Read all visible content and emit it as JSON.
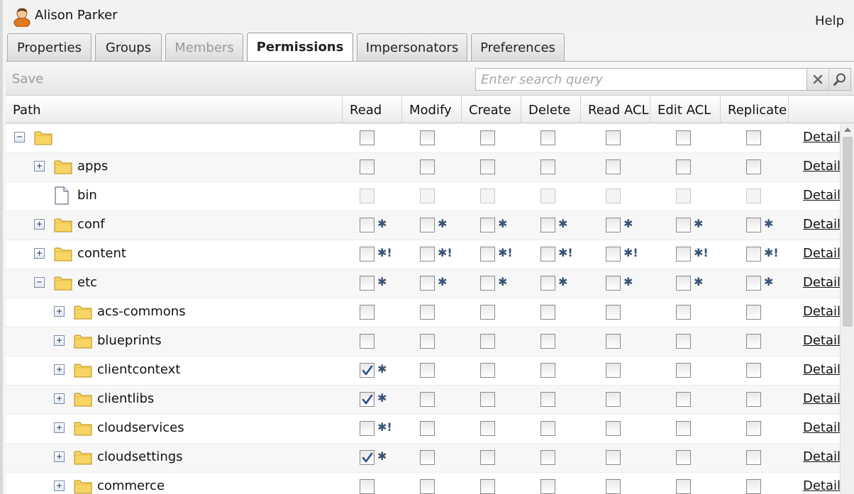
{
  "header": {
    "user_name": "Alison Parker",
    "help_label": "Help"
  },
  "tabs": [
    {
      "label": "Properties",
      "state": "normal"
    },
    {
      "label": "Groups",
      "state": "normal"
    },
    {
      "label": "Members",
      "state": "disabled"
    },
    {
      "label": "Permissions",
      "state": "active"
    },
    {
      "label": "Impersonators",
      "state": "normal"
    },
    {
      "label": "Preferences",
      "state": "normal"
    }
  ],
  "toolbar": {
    "save_label": "Save",
    "search_placeholder": "Enter search query",
    "search_value": ""
  },
  "columns": {
    "path": "Path",
    "permissions": [
      "Read",
      "Modify",
      "Create",
      "Delete",
      "Read ACL",
      "Edit ACL",
      "Replicate"
    ]
  },
  "details_label": "Details",
  "rows": [
    {
      "label": "",
      "depth": 0,
      "expander": "minus",
      "icon": "folder-icon",
      "perms": [
        {
          "checked": false,
          "mark": ""
        },
        {
          "checked": false,
          "mark": ""
        },
        {
          "checked": false,
          "mark": ""
        },
        {
          "checked": false,
          "mark": ""
        },
        {
          "checked": false,
          "mark": ""
        },
        {
          "checked": false,
          "mark": ""
        },
        {
          "checked": false,
          "mark": ""
        }
      ]
    },
    {
      "label": "apps",
      "depth": 1,
      "expander": "plus",
      "icon": "folder-icon",
      "perms": [
        {
          "checked": false,
          "mark": ""
        },
        {
          "checked": false,
          "mark": ""
        },
        {
          "checked": false,
          "mark": ""
        },
        {
          "checked": false,
          "mark": ""
        },
        {
          "checked": false,
          "mark": ""
        },
        {
          "checked": false,
          "mark": ""
        },
        {
          "checked": false,
          "mark": ""
        }
      ]
    },
    {
      "label": "bin",
      "depth": 1,
      "expander": "none",
      "icon": "file-icon",
      "disabled": true,
      "perms": [
        {
          "checked": false,
          "mark": ""
        },
        {
          "checked": false,
          "mark": ""
        },
        {
          "checked": false,
          "mark": ""
        },
        {
          "checked": false,
          "mark": ""
        },
        {
          "checked": false,
          "mark": ""
        },
        {
          "checked": false,
          "mark": ""
        },
        {
          "checked": false,
          "mark": ""
        }
      ]
    },
    {
      "label": "conf",
      "depth": 1,
      "expander": "plus",
      "icon": "folder-icon",
      "perms": [
        {
          "checked": false,
          "mark": "✱"
        },
        {
          "checked": false,
          "mark": "✱"
        },
        {
          "checked": false,
          "mark": "✱"
        },
        {
          "checked": false,
          "mark": "✱"
        },
        {
          "checked": false,
          "mark": "✱"
        },
        {
          "checked": false,
          "mark": "✱"
        },
        {
          "checked": false,
          "mark": "✱"
        }
      ]
    },
    {
      "label": "content",
      "depth": 1,
      "expander": "plus",
      "icon": "folder-icon",
      "perms": [
        {
          "checked": false,
          "mark": "✱!"
        },
        {
          "checked": false,
          "mark": "✱!"
        },
        {
          "checked": false,
          "mark": "✱!"
        },
        {
          "checked": false,
          "mark": "✱!"
        },
        {
          "checked": false,
          "mark": "✱!"
        },
        {
          "checked": false,
          "mark": "✱!"
        },
        {
          "checked": false,
          "mark": "✱!"
        }
      ]
    },
    {
      "label": "etc",
      "depth": 1,
      "expander": "minus",
      "icon": "folder-icon",
      "perms": [
        {
          "checked": false,
          "mark": "✱"
        },
        {
          "checked": false,
          "mark": "✱"
        },
        {
          "checked": false,
          "mark": "✱"
        },
        {
          "checked": false,
          "mark": "✱"
        },
        {
          "checked": false,
          "mark": "✱"
        },
        {
          "checked": false,
          "mark": "✱"
        },
        {
          "checked": false,
          "mark": "✱"
        }
      ]
    },
    {
      "label": "acs-commons",
      "depth": 2,
      "expander": "plus",
      "icon": "folder-icon",
      "perms": [
        {
          "checked": false,
          "mark": ""
        },
        {
          "checked": false,
          "mark": ""
        },
        {
          "checked": false,
          "mark": ""
        },
        {
          "checked": false,
          "mark": ""
        },
        {
          "checked": false,
          "mark": ""
        },
        {
          "checked": false,
          "mark": ""
        },
        {
          "checked": false,
          "mark": ""
        }
      ]
    },
    {
      "label": "blueprints",
      "depth": 2,
      "expander": "plus",
      "icon": "folder-icon",
      "perms": [
        {
          "checked": false,
          "mark": ""
        },
        {
          "checked": false,
          "mark": ""
        },
        {
          "checked": false,
          "mark": ""
        },
        {
          "checked": false,
          "mark": ""
        },
        {
          "checked": false,
          "mark": ""
        },
        {
          "checked": false,
          "mark": ""
        },
        {
          "checked": false,
          "mark": ""
        }
      ]
    },
    {
      "label": "clientcontext",
      "depth": 2,
      "expander": "plus",
      "icon": "folder-icon",
      "perms": [
        {
          "checked": true,
          "mark": "✱"
        },
        {
          "checked": false,
          "mark": ""
        },
        {
          "checked": false,
          "mark": ""
        },
        {
          "checked": false,
          "mark": ""
        },
        {
          "checked": false,
          "mark": ""
        },
        {
          "checked": false,
          "mark": ""
        },
        {
          "checked": false,
          "mark": ""
        }
      ]
    },
    {
      "label": "clientlibs",
      "depth": 2,
      "expander": "plus",
      "icon": "folder-icon",
      "perms": [
        {
          "checked": true,
          "mark": "✱"
        },
        {
          "checked": false,
          "mark": ""
        },
        {
          "checked": false,
          "mark": ""
        },
        {
          "checked": false,
          "mark": ""
        },
        {
          "checked": false,
          "mark": ""
        },
        {
          "checked": false,
          "mark": ""
        },
        {
          "checked": false,
          "mark": ""
        }
      ]
    },
    {
      "label": "cloudservices",
      "depth": 2,
      "expander": "plus",
      "icon": "folder-icon",
      "perms": [
        {
          "checked": false,
          "mark": "✱!"
        },
        {
          "checked": false,
          "mark": ""
        },
        {
          "checked": false,
          "mark": ""
        },
        {
          "checked": false,
          "mark": ""
        },
        {
          "checked": false,
          "mark": ""
        },
        {
          "checked": false,
          "mark": ""
        },
        {
          "checked": false,
          "mark": ""
        }
      ]
    },
    {
      "label": "cloudsettings",
      "depth": 2,
      "expander": "plus",
      "icon": "folder-icon",
      "perms": [
        {
          "checked": true,
          "mark": "✱"
        },
        {
          "checked": false,
          "mark": ""
        },
        {
          "checked": false,
          "mark": ""
        },
        {
          "checked": false,
          "mark": ""
        },
        {
          "checked": false,
          "mark": ""
        },
        {
          "checked": false,
          "mark": ""
        },
        {
          "checked": false,
          "mark": ""
        }
      ]
    },
    {
      "label": "commerce",
      "depth": 2,
      "expander": "plus",
      "icon": "folder-icon",
      "perms": [
        {
          "checked": false,
          "mark": ""
        },
        {
          "checked": false,
          "mark": ""
        },
        {
          "checked": false,
          "mark": ""
        },
        {
          "checked": false,
          "mark": ""
        },
        {
          "checked": false,
          "mark": ""
        },
        {
          "checked": false,
          "mark": ""
        },
        {
          "checked": false,
          "mark": ""
        }
      ]
    }
  ]
}
